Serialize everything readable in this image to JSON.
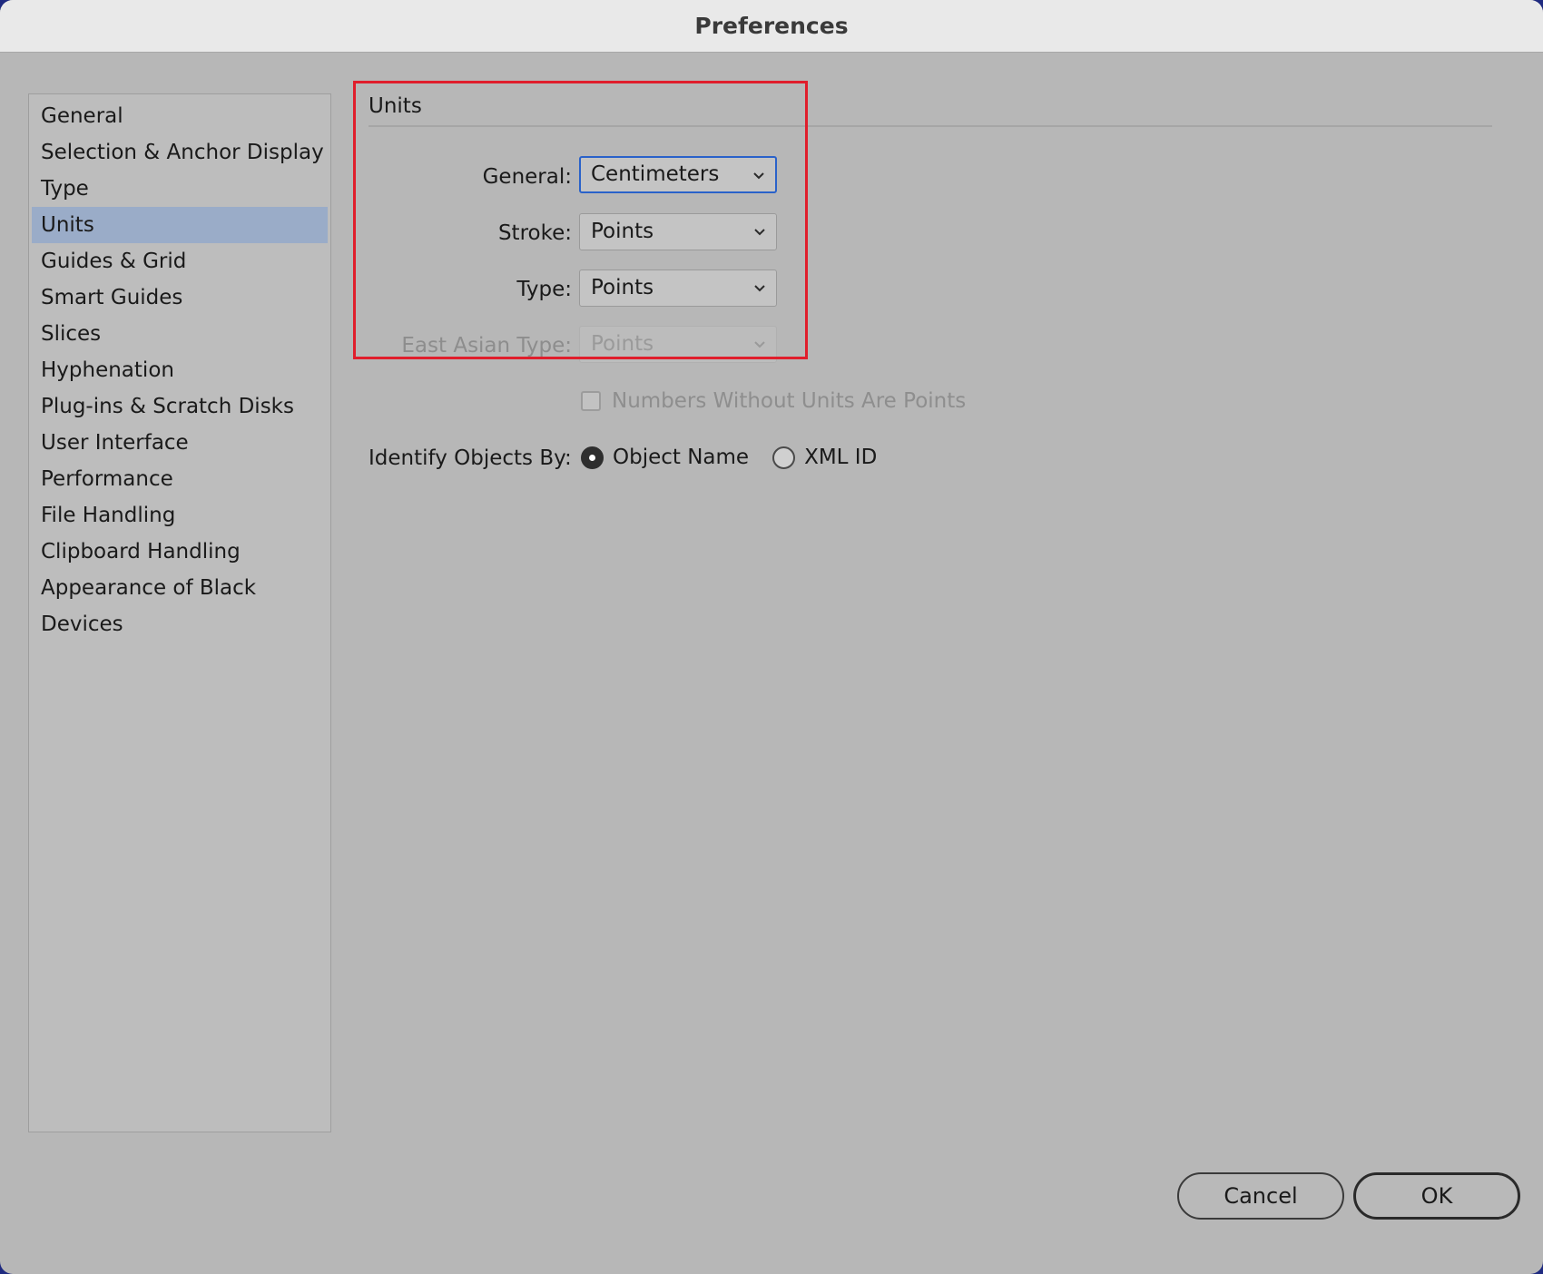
{
  "window": {
    "title": "Preferences"
  },
  "sidebar": {
    "items": [
      {
        "label": "General"
      },
      {
        "label": "Selection & Anchor Display"
      },
      {
        "label": "Type"
      },
      {
        "label": "Units",
        "selected": true
      },
      {
        "label": "Guides & Grid"
      },
      {
        "label": "Smart Guides"
      },
      {
        "label": "Slices"
      },
      {
        "label": "Hyphenation"
      },
      {
        "label": "Plug-ins & Scratch Disks"
      },
      {
        "label": "User Interface"
      },
      {
        "label": "Performance"
      },
      {
        "label": "File Handling"
      },
      {
        "label": "Clipboard Handling"
      },
      {
        "label": "Appearance of Black"
      },
      {
        "label": "Devices"
      }
    ]
  },
  "units": {
    "section_title": "Units",
    "general": {
      "label": "General:",
      "value": "Centimeters"
    },
    "stroke": {
      "label": "Stroke:",
      "value": "Points"
    },
    "type": {
      "label": "Type:",
      "value": "Points"
    },
    "east_asian_type": {
      "label": "East Asian Type:",
      "value": "Points",
      "disabled": true
    },
    "numbers_without_units": {
      "label": "Numbers Without Units Are Points",
      "checked": false,
      "disabled": true
    },
    "identify_objects": {
      "label": "Identify Objects By:",
      "options": [
        {
          "label": "Object Name",
          "checked": true
        },
        {
          "label": "XML ID",
          "checked": false
        }
      ]
    }
  },
  "footer": {
    "cancel_label": "Cancel",
    "ok_label": "OK"
  },
  "colors": {
    "highlight_box": "#e01e2c",
    "selection": "#9aacc8",
    "focus_ring": "#2a62c9"
  }
}
